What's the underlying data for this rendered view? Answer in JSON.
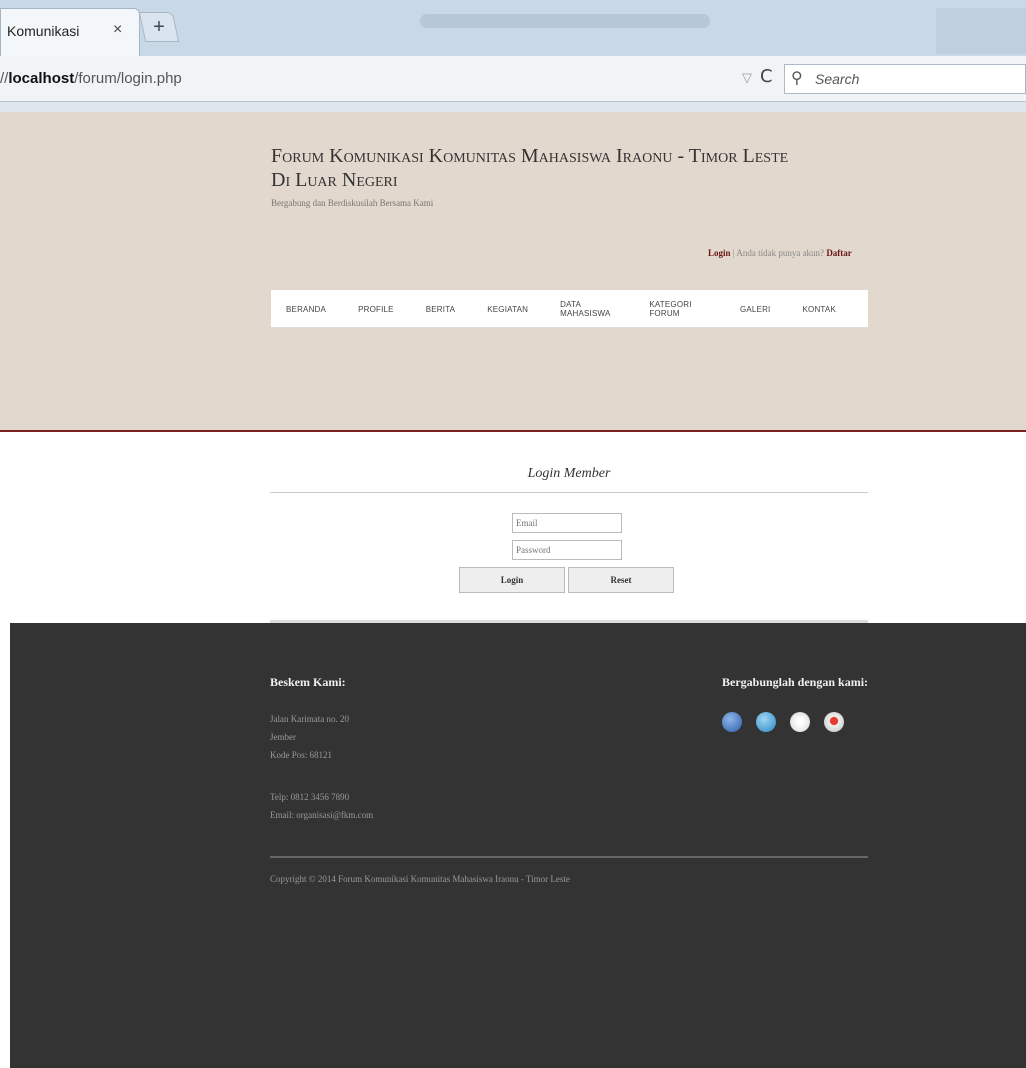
{
  "browser": {
    "tab_title": "Komunikasi",
    "tab_close": "×",
    "new_tab": "+",
    "url_prefix": "//",
    "url_host": "localhost",
    "url_path": "/forum/login.php",
    "dropdown_icon": "▽",
    "reload_icon": "C",
    "search_icon": "⚲",
    "search_placeholder": "Search"
  },
  "header": {
    "title_line1": "Forum Komunikasi Komunitas Mahasiswa Iraonu - Timor Leste",
    "title_line2": "Di Luar Negeri",
    "tagline": "Bergabung dan Berdiskusilah Bersama Kami",
    "login_label": "Login",
    "separator": " | ",
    "no_account_text": "Anda tidak punya akun?",
    "register_label": "Daftar"
  },
  "nav": {
    "items": [
      "BERANDA",
      "PROFILE",
      "BERITA",
      "KEGIATAN",
      "DATA MAHASISWA",
      "KATEGORI FORUM",
      "GALERI",
      "KONTAK"
    ]
  },
  "login": {
    "title": "Login Member",
    "email_placeholder": "Email",
    "password_placeholder": "Password",
    "login_button": "Login",
    "reset_button": "Reset"
  },
  "footer": {
    "address_heading": "Beskem Kami:",
    "address_line1": "Jalan Karimata no. 20",
    "address_line2": "Jember",
    "address_line3": "Kode Pos: 68121",
    "phone": "Telp: 0812 3456 7890",
    "email": "Email: organisasi@fkm.com",
    "social_heading": "Bergabunglah dengan kami:",
    "social_icons": [
      "facebook-icon",
      "twitter-icon",
      "flickr-icon",
      "youtube-icon"
    ],
    "copyright": "Copyright © 2014 Forum Komunikasi Komunitas Mahasiswa Iraonu - Timor Leste"
  },
  "colors": {
    "header_bg": "#e3d8cd",
    "footer_bg": "#333333",
    "accent": "#7a2020"
  }
}
